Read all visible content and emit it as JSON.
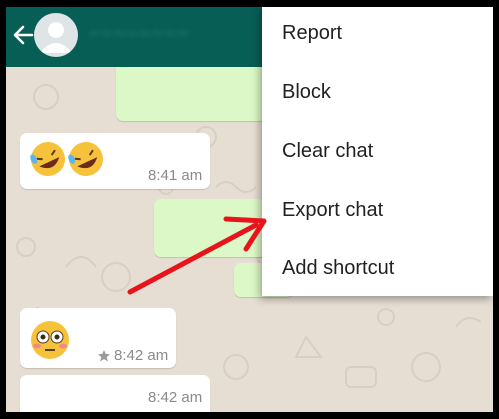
{
  "header": {
    "contact_name": "~~~~~~~~"
  },
  "menu": {
    "items": [
      "Report",
      "Block",
      "Clear chat",
      "Export chat",
      "Add shortcut"
    ]
  },
  "messages": [
    {
      "direction": "outgoing",
      "text": ""
    },
    {
      "direction": "incoming",
      "content": "emoji",
      "emoji": "rolling-on-floor-laughing x2",
      "time": "8:41 am"
    },
    {
      "direction": "outgoing",
      "text": ""
    },
    {
      "direction": "outgoing",
      "text": ""
    },
    {
      "direction": "incoming",
      "content": "emoji",
      "emoji": "flushed-face",
      "time": "8:42 am",
      "starred": true
    },
    {
      "direction": "incoming",
      "text": "",
      "time": "8:42 am"
    }
  ],
  "annotation": {
    "arrow_color": "#e8141c"
  },
  "colors": {
    "app_bar": "#075e54",
    "incoming_bubble": "#ffffff",
    "outgoing_bubble": "#dcf8c6",
    "chat_background": "#e7ded3"
  }
}
